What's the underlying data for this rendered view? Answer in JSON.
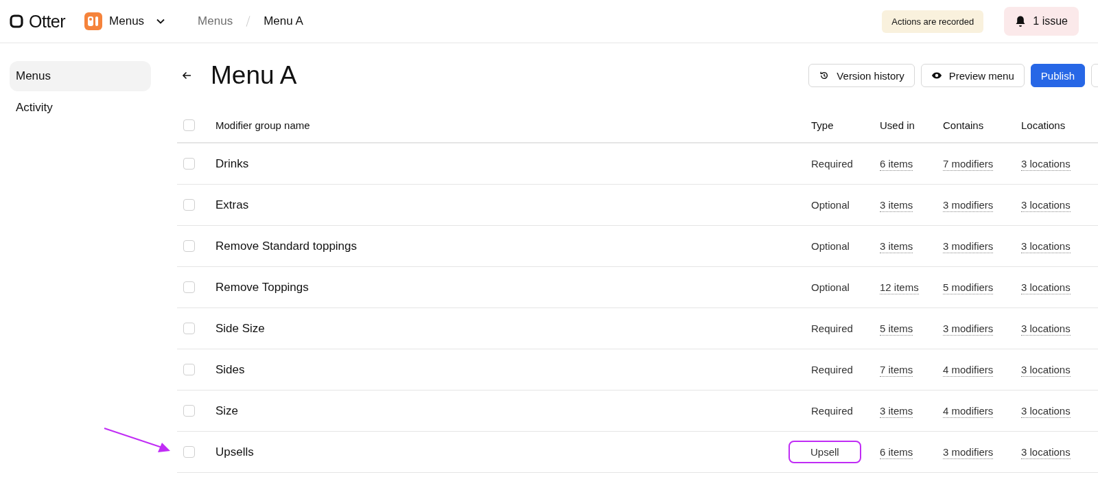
{
  "header": {
    "logo": "Otter",
    "app_switcher": "Menus",
    "breadcrumb": [
      "Menus",
      "Menu A"
    ],
    "recording_notice": "Actions are recorded",
    "issues_button": "1 issue"
  },
  "sidebar": {
    "items": [
      {
        "label": "Menus",
        "selected": true
      },
      {
        "label": "Activity",
        "selected": false
      }
    ]
  },
  "page": {
    "title": "Menu A",
    "buttons": [
      {
        "label": "Version history",
        "kind": "history"
      },
      {
        "label": "Preview menu",
        "kind": "preview"
      },
      {
        "label": "Publish",
        "kind": "primary"
      }
    ]
  },
  "table": {
    "select_all_checked": false,
    "columns": [
      "Modifier group name",
      "Type",
      "Used in",
      "Contains",
      "Locations"
    ],
    "rows": [
      {
        "name": "Drinks",
        "type": "Required",
        "used_in": "6 items",
        "contains": "7 modifiers",
        "locations": "3 locations",
        "checked": false,
        "highlighted": false
      },
      {
        "name": "Extras",
        "type": "Optional",
        "used_in": "3 items",
        "contains": "3 modifiers",
        "locations": "3 locations",
        "checked": false,
        "highlighted": false
      },
      {
        "name": "Remove Standard toppings",
        "type": "Optional",
        "used_in": "3 items",
        "contains": "3 modifiers",
        "locations": "3 locations",
        "checked": false,
        "highlighted": false
      },
      {
        "name": "Remove Toppings",
        "type": "Optional",
        "used_in": "12 items",
        "contains": "5 modifiers",
        "locations": "3 locations",
        "checked": false,
        "highlighted": false
      },
      {
        "name": "Side Size",
        "type": "Required",
        "used_in": "5 items",
        "contains": "3 modifiers",
        "locations": "3 locations",
        "checked": false,
        "highlighted": false
      },
      {
        "name": "Sides",
        "type": "Required",
        "used_in": "7 items",
        "contains": "4 modifiers",
        "locations": "3 locations",
        "checked": false,
        "highlighted": false
      },
      {
        "name": "Size",
        "type": "Required",
        "used_in": "3 items",
        "contains": "4 modifiers",
        "locations": "3 locations",
        "checked": false,
        "highlighted": false
      },
      {
        "name": "Upsells",
        "type": "Upsell",
        "used_in": "6 items",
        "contains": "3 modifiers",
        "locations": "3 locations",
        "checked": false,
        "highlighted": true
      }
    ]
  }
}
